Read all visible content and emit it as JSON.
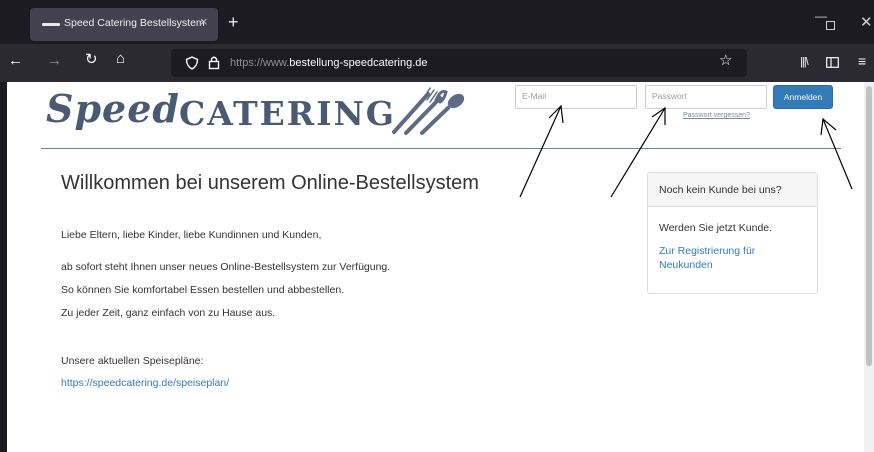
{
  "browser": {
    "tab_title": "Speed Catering Bestellsystem",
    "tab_close": "×",
    "new_tab": "+",
    "url_prefix": "https://www.",
    "url_domain": "bestellung-speedcatering.de"
  },
  "logo": {
    "speed": "Speed",
    "catering": "CATERING"
  },
  "login": {
    "email_placeholder": "E-Mail",
    "password_placeholder": "Passwort",
    "submit_label": "Anmelden",
    "forgot_label": "Passwort vergessen?"
  },
  "main": {
    "heading": "Willkommen bei unserem Online-Bestellsystem",
    "greeting": "Liebe Eltern, liebe Kinder, liebe Kundinnen und Kunden,",
    "lines": [
      "ab sofort steht Ihnen unser neues Online-Bestellsystem zur Verfügung.",
      "So können Sie komfortabel Essen bestellen und abbestellen.",
      "Zu jeder Zeit, ganz einfach von zu Hause aus."
    ],
    "menus_label": "Unsere aktuellen Speisepläne:",
    "menus_link": "https://speedcatering.de/speiseplan/"
  },
  "panel": {
    "title": "Noch kein Kunde bei uns?",
    "text": "Werden Sie jetzt Kunde.",
    "link": "Zur Registrierung für Neukunden"
  },
  "colors": {
    "brand_text": "#4a5a73",
    "primary_button": "#337ab7",
    "link": "#337ab7"
  }
}
